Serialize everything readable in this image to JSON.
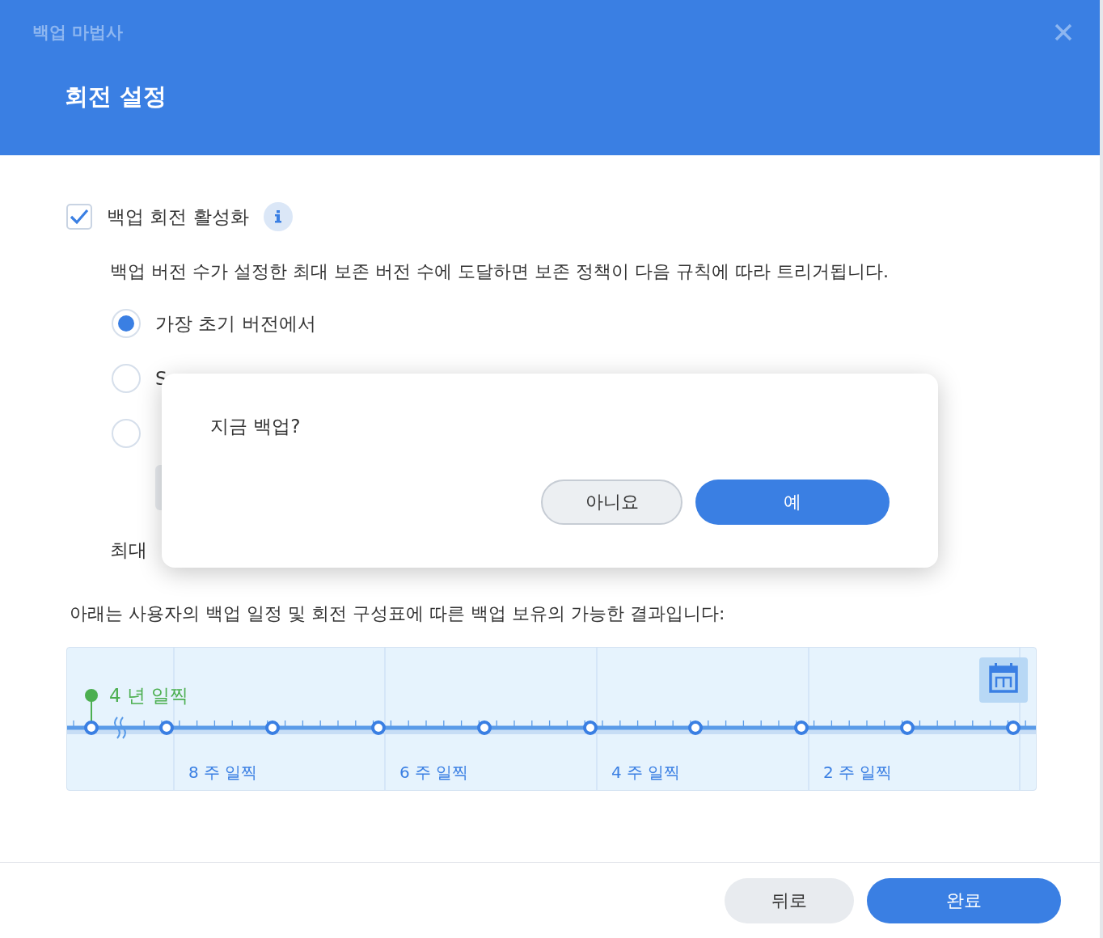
{
  "dialog": {
    "wizard_title": "백업 마법사",
    "step_title": "회전 설정"
  },
  "rotation": {
    "label": "백업 회전 활성화",
    "checked": true
  },
  "description": "백업 버전 수가 설정한 최대 보존 버전 수에 도달하면 보존 정책이 다음 규칙에 따라 트리거됩니다.",
  "options": [
    {
      "label": "가장 초기 버전에서",
      "selected": true
    },
    {
      "label": "S",
      "selected": false
    },
    {
      "selected": false
    }
  ],
  "max_versions_label": "최대",
  "result_caption": "아래는 사용자의 백업 일정 및 회전 구성표에 따른 백업 보유의 가능한 결과입니다:",
  "timeline": {
    "oldest": "4 년 일찍",
    "columns": [
      "8 주 일찍",
      "6 주 일찍",
      "4 주 일찍",
      "2 주 일찍"
    ]
  },
  "confirm": {
    "message": "지금 백업?",
    "buttons": [
      {
        "label": "아니요",
        "kind": "secondary"
      },
      {
        "label": "예",
        "kind": "primary"
      }
    ]
  },
  "footer": {
    "buttons": [
      {
        "label": "뒤로",
        "kind": "secondary"
      },
      {
        "label": "완료",
        "kind": "primary"
      }
    ]
  }
}
